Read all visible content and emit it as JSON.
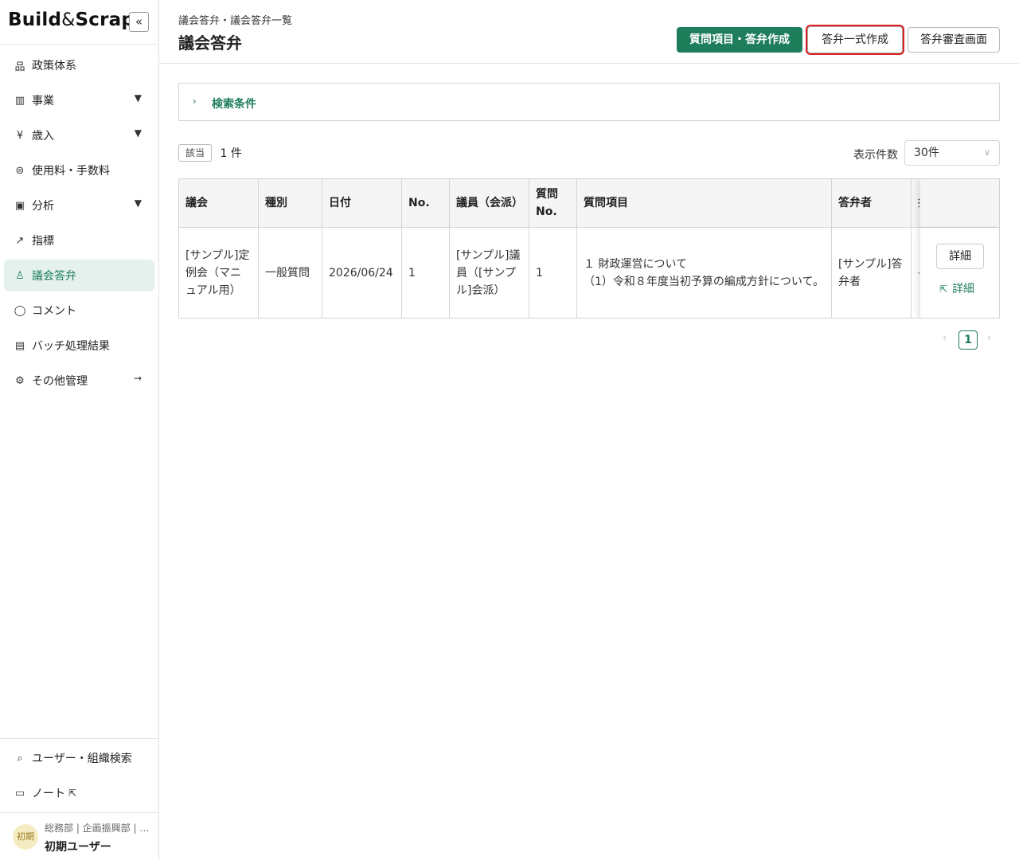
{
  "sidebar": {
    "logo_part1": "Build",
    "logo_amp": "&",
    "logo_part2": "Scrap",
    "collapse_icon": "double-chevron-left-icon",
    "items": [
      {
        "label": "政策体系",
        "icon": "hierarchy-icon",
        "chevron": ""
      },
      {
        "label": "事業",
        "icon": "bar-chart-icon",
        "chevron": "down"
      },
      {
        "label": "歳入",
        "icon": "yen-document-icon",
        "chevron": "down"
      },
      {
        "label": "使用料・手数料",
        "icon": "hand-coin-icon",
        "chevron": ""
      },
      {
        "label": "分析",
        "icon": "board-icon",
        "chevron": "down"
      },
      {
        "label": "指標",
        "icon": "trend-line-icon",
        "chevron": ""
      },
      {
        "label": "議会答弁",
        "icon": "podium-icon",
        "chevron": "",
        "active": true
      },
      {
        "label": "コメント",
        "icon": "comment-icon",
        "chevron": ""
      },
      {
        "label": "バッチ処理結果",
        "icon": "terminal-icon",
        "chevron": ""
      },
      {
        "label": "その他管理",
        "icon": "gear-icon",
        "chevron": "right"
      }
    ],
    "bottom_items": [
      {
        "label": "ユーザー・組織検索",
        "icon": "search-icon"
      },
      {
        "label": "ノート",
        "icon": "book-icon",
        "external_icon": "external-link-icon"
      }
    ],
    "user": {
      "avatar_text": "初期",
      "department": "総務部 | 企画振興部 | …",
      "name": "初期ユーザー"
    }
  },
  "header": {
    "breadcrumb": "議会答弁・議会答弁一覧",
    "title": "議会答弁",
    "primary_button": "質問項目・答弁作成",
    "bulk_button": "答弁一式作成",
    "review_button": "答弁審査画面"
  },
  "search_panel": {
    "label": "検索条件"
  },
  "results": {
    "badge": "該当",
    "count": "1 件",
    "page_size_label": "表示件数",
    "page_size_value": "30件"
  },
  "table": {
    "headers": [
      "議会",
      "種別",
      "日付",
      "No.",
      "議員（会派）",
      "質問No.",
      "質問項目",
      "答弁者",
      "担"
    ],
    "rows": [
      {
        "council": "[サンプル]定例会（マニュアル用）",
        "type": "一般質問",
        "date": "2026/06/24",
        "no": "1",
        "member": "[サンプル]議員（[サンプル]会派）",
        "question_no": "1",
        "question_line1": "１ 財政運営について",
        "question_line2": "（1）令和８年度当初予算の編成方針について。",
        "answerer": "[サンプル]答弁者",
        "clipped": "-",
        "detail_button": "詳細",
        "detail_link": "詳細"
      }
    ]
  },
  "pagination": {
    "current": "1",
    "prev": "‹",
    "next": "›"
  },
  "colors": {
    "accent": "#1e7d5b",
    "active_bg": "#e4f1ec",
    "highlight": "#e02020"
  }
}
